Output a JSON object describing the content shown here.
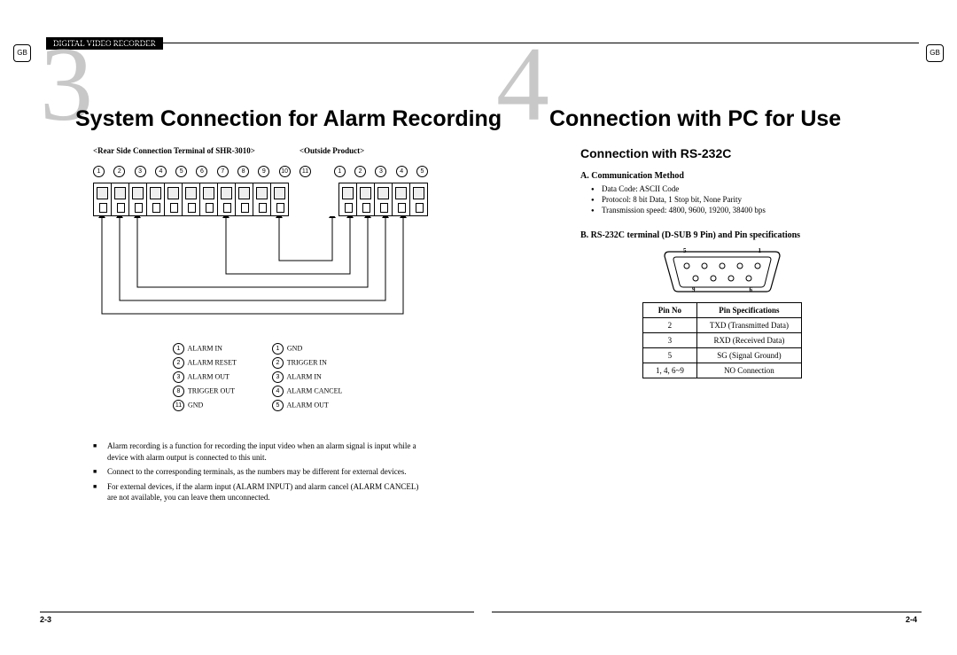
{
  "gb_label": "GB",
  "header_label": "DIGITAL VIDEO RECORDER",
  "left": {
    "chapter_num": "3",
    "title": "System Connection for Alarm Recording",
    "terminal_label_a": "<Rear Side Connection Terminal of SHR-3010>",
    "terminal_label_b": "<Outside Product>",
    "legend_col1": [
      {
        "n": "1",
        "t": "ALARM IN"
      },
      {
        "n": "2",
        "t": "ALARM RESET"
      },
      {
        "n": "3",
        "t": "ALARM OUT"
      },
      {
        "n": "8",
        "t": "TRIGGER OUT"
      },
      {
        "n": "11",
        "t": "GND"
      }
    ],
    "legend_col2": [
      {
        "n": "1",
        "t": "GND"
      },
      {
        "n": "2",
        "t": "TRIGGER IN"
      },
      {
        "n": "3",
        "t": "ALARM IN"
      },
      {
        "n": "4",
        "t": "ALARM CANCEL"
      },
      {
        "n": "5",
        "t": "ALARM OUT"
      }
    ],
    "notes": [
      "Alarm recording is a function for recording the input video when an alarm signal is input while a device with alarm output is connected to this unit.",
      "Connect to the corresponding terminals, as the numbers may be different for external devices.",
      "For external devices, if the alarm input (ALARM INPUT) and alarm cancel (ALARM CANCEL) are not available, you can leave them unconnected."
    ],
    "page_num": "2-3"
  },
  "right": {
    "chapter_num": "4",
    "title": "Connection with PC for Use",
    "section": "Connection with RS-232C",
    "sub_a": "A. Communication Method",
    "bullets_a": [
      "Data Code: ASCII Code",
      "Protocol: 8 bit Data, 1 Stop bit, None Parity",
      "Transmission speed: 4800, 9600, 19200, 38400 bps"
    ],
    "sub_b": "B. RS-232C terminal (D-SUB 9 Pin) and Pin specifications",
    "dsub_labels": {
      "tl": "5",
      "tr": "1",
      "bl": "9",
      "br": "6"
    },
    "table": {
      "head": [
        "Pin No",
        "Pin Specifications"
      ],
      "rows": [
        [
          "2",
          "TXD (Transmitted Data)"
        ],
        [
          "3",
          "RXD (Received Data)"
        ],
        [
          "5",
          "SG (Signal Ground)"
        ],
        [
          "1, 4, 6~9",
          "NO Connection"
        ]
      ]
    },
    "page_num": "2-4"
  }
}
